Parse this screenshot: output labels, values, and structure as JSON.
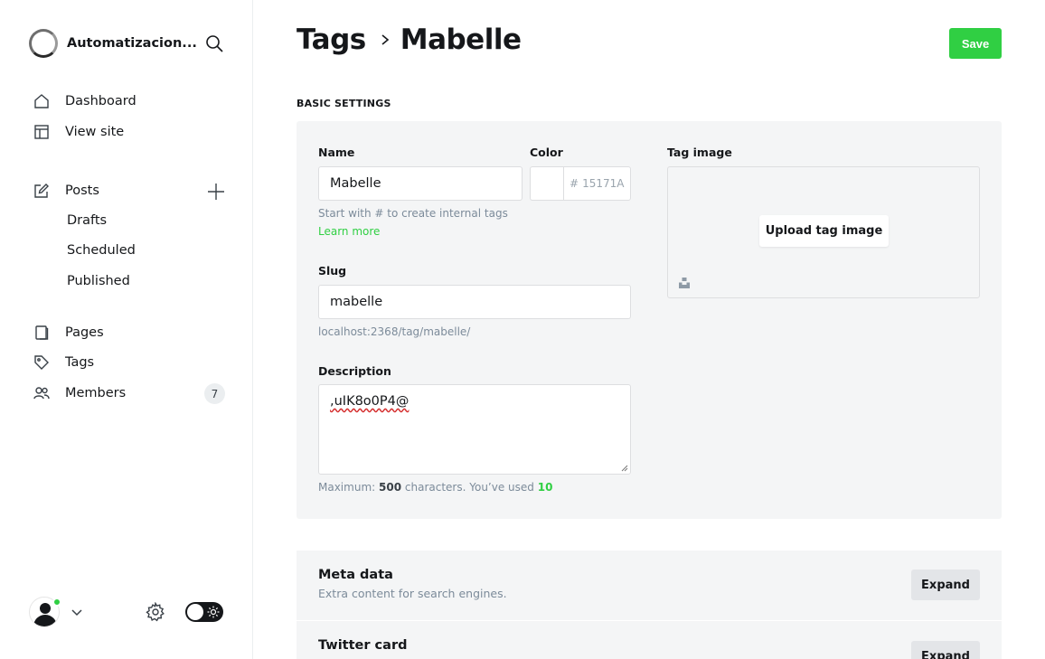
{
  "sidebar": {
    "site_name": "Automatizacion...",
    "nav": {
      "dashboard": "Dashboard",
      "view_site": "View site",
      "posts": "Posts",
      "drafts": "Drafts",
      "scheduled": "Scheduled",
      "published": "Published",
      "pages": "Pages",
      "tags": "Tags",
      "members": "Members",
      "members_count": "7"
    }
  },
  "header": {
    "breadcrumb_parent": "Tags",
    "breadcrumb_current": "Mabelle",
    "save_label": "Save"
  },
  "basic_settings": {
    "section_title": "BASIC SETTINGS",
    "name_label": "Name",
    "name_value": "Mabelle",
    "name_hint": "Start with # to create internal tags",
    "learn_more": "Learn more",
    "color_label": "Color",
    "color_hash": "#",
    "color_placeholder": "15171A",
    "tag_image_label": "Tag image",
    "upload_label": "Upload tag image",
    "slug_label": "Slug",
    "slug_value": "mabelle",
    "slug_url": "localhost:2368/tag/mabelle/",
    "description_label": "Description",
    "description_value": ",uIK8o0P4@",
    "desc_hint_prefix": "Maximum:",
    "desc_hint_max": "500",
    "desc_hint_mid": "characters. You’ve used",
    "desc_hint_used": "10"
  },
  "meta_data": {
    "title": "Meta data",
    "subtitle": "Extra content for search engines.",
    "expand_label": "Expand"
  },
  "twitter_card": {
    "title": "Twitter card",
    "expand_label": "Expand"
  },
  "colors": {
    "accent": "#30cf43",
    "panel": "#f4f5f6",
    "text": "#15171a",
    "muted": "#7c8b9a"
  }
}
